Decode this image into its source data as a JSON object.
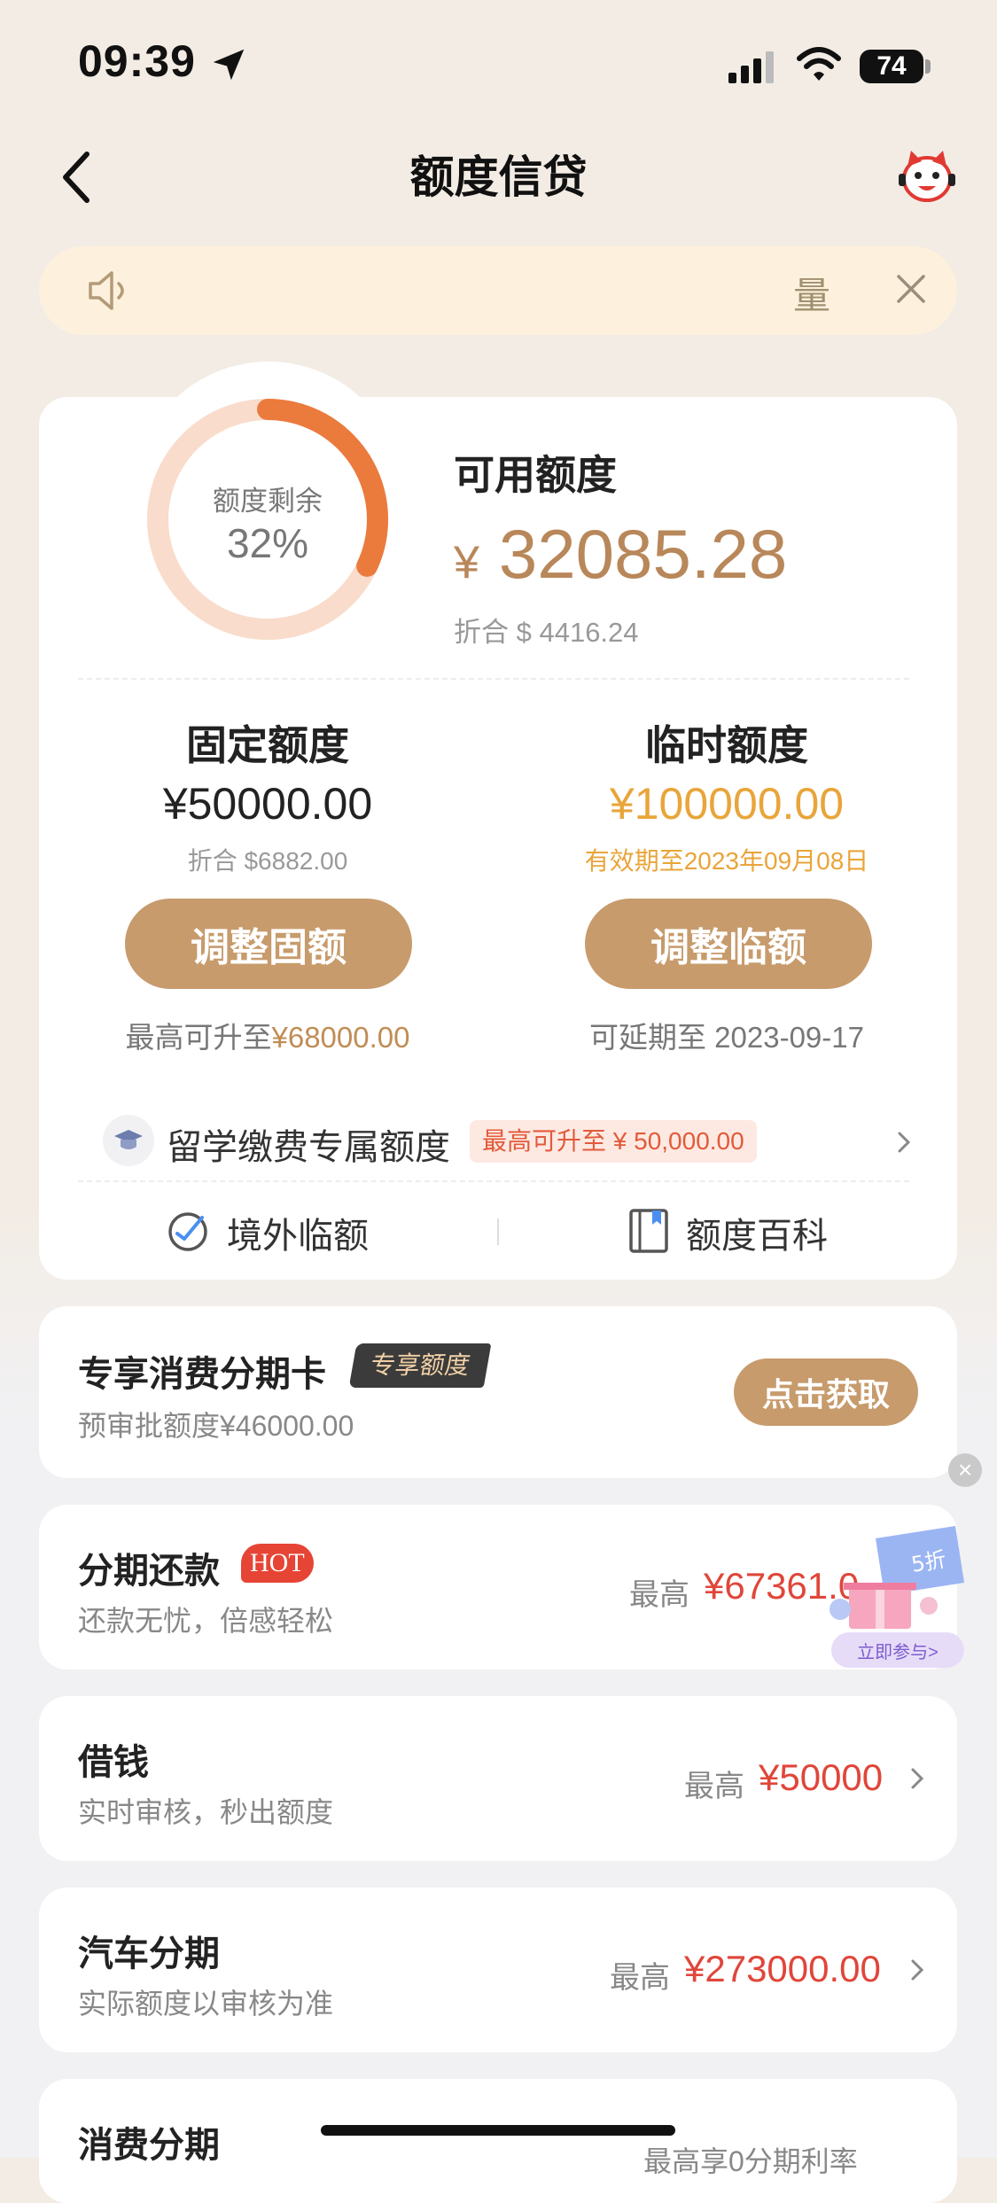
{
  "status_bar": {
    "time": "09:39",
    "battery": "74"
  },
  "nav": {
    "title": "额度信贷"
  },
  "notice": {
    "text": "量"
  },
  "quota": {
    "ring_label": "额度剩余",
    "ring_percent": "32%",
    "ring_fraction": 0.32,
    "available_title": "可用额度",
    "available_currency": "¥",
    "available_amount": "32085.28",
    "available_converted": "折合 $ 4416.24"
  },
  "fixed": {
    "title": "固定额度",
    "amount": "¥50000.00",
    "converted": "折合 $6882.00",
    "button": "调整固额",
    "note_prefix": "最高可升至",
    "note_value": "¥68000.00"
  },
  "temporary": {
    "title": "临时额度",
    "amount": "¥100000.00",
    "validity": "有效期至2023年09月08日",
    "button": "调整临额",
    "note": "可延期至 2023-09-17"
  },
  "study": {
    "label": "留学缴费专属额度",
    "badge": "最高可升至 ¥ 50,000.00"
  },
  "links": {
    "overseas": "境外临额",
    "encyclopedia": "额度百科"
  },
  "installment_card": {
    "title": "专享消费分期卡",
    "badge": "专享额度",
    "subtitle": "预审批额度¥46000.00",
    "button": "点击获取"
  },
  "rows": [
    {
      "title": "分期还款",
      "tag": "HOT",
      "subtitle": "还款无忧，倍感轻松",
      "high": "最高",
      "amount": "¥67361.0"
    },
    {
      "title": "借钱",
      "subtitle": "实时审核，秒出额度",
      "high": "最高",
      "amount": "¥50000"
    },
    {
      "title": "汽车分期",
      "subtitle": "实际额度以审核为准",
      "high": "最高",
      "amount": "¥273000.00"
    },
    {
      "title": "消费分期",
      "subtitle": "最高享0分期利率"
    }
  ],
  "promo": {
    "discount": "5折",
    "button": "立即参与>"
  },
  "colors": {
    "accent_gold": "#c79b6c",
    "ring_orange": "#eb7a3d",
    "ring_track": "#f9dccb",
    "amount_red": "#e0463a",
    "temp_orange": "#e9a53a"
  }
}
